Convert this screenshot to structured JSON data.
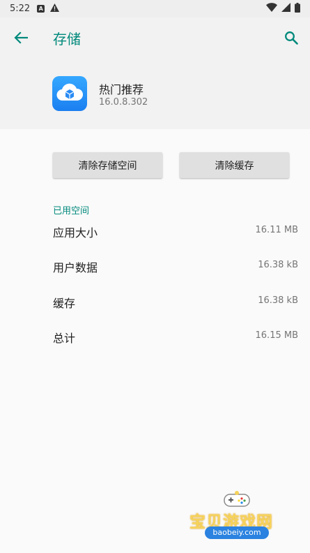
{
  "status_bar": {
    "time": "5:22",
    "notification_badge": "A"
  },
  "header": {
    "title": "存储"
  },
  "app": {
    "name": "热门推荐",
    "version": "16.0.8.302"
  },
  "buttons": {
    "clear_storage": "清除存储空间",
    "clear_cache": "清除缓存"
  },
  "storage": {
    "section_label": "已用空间",
    "rows": [
      {
        "label": "应用大小",
        "value": "16.11 MB"
      },
      {
        "label": "用户数据",
        "value": "16.38 kB"
      },
      {
        "label": "缓存",
        "value": "16.38 kB"
      },
      {
        "label": "总计",
        "value": "16.15 MB"
      }
    ]
  },
  "watermark": {
    "text": "宝贝游戏网",
    "url": "baobeiy.com"
  },
  "colors": {
    "accent": "#00897b",
    "header_bg": "#f2f2f2",
    "button_bg": "#e0e0e0",
    "app_icon": "#1e88f0"
  }
}
